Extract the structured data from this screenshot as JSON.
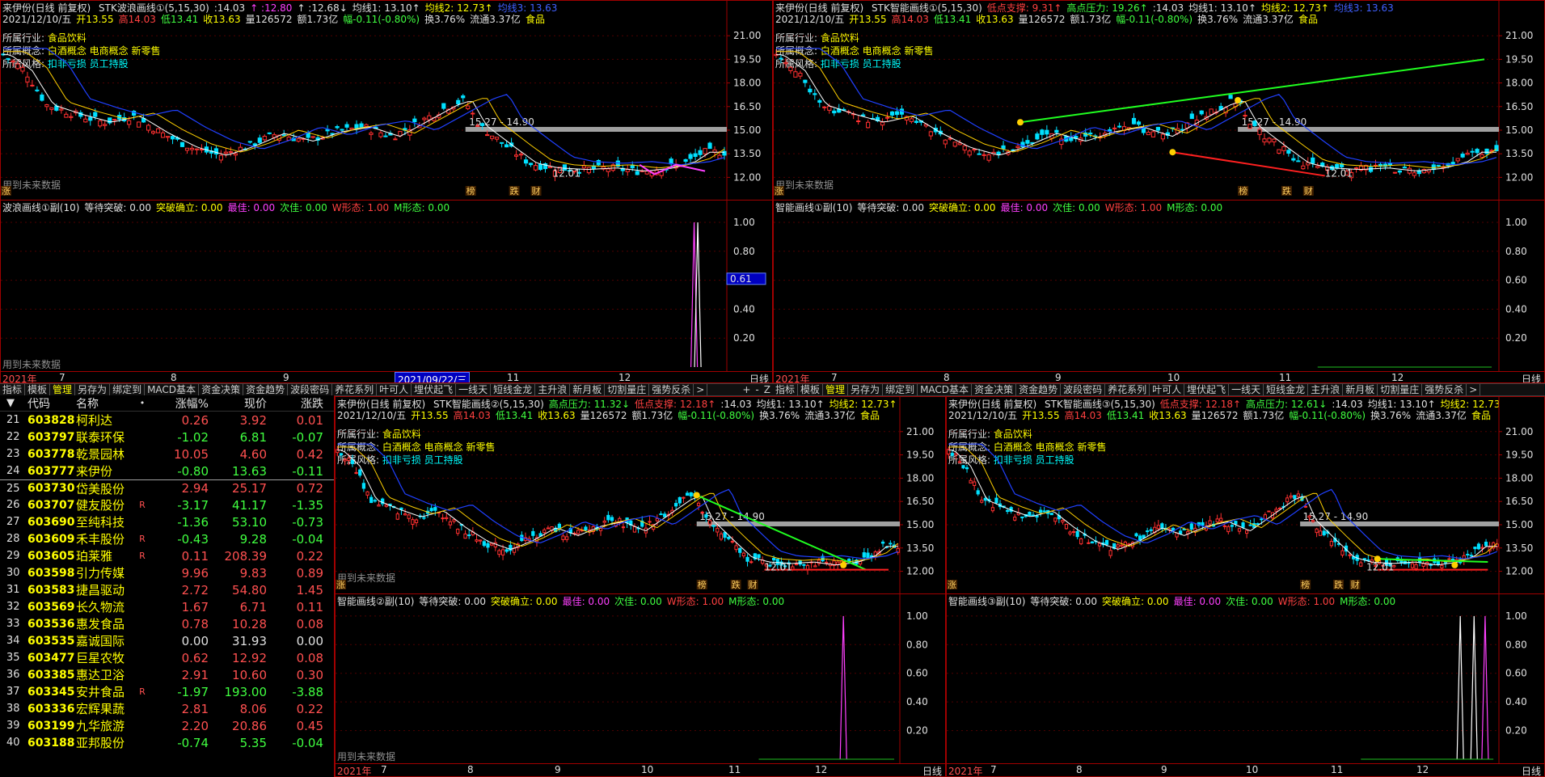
{
  "stock": {
    "name_period": "来伊份(日线 前复权)",
    "quote": [
      "2021/12/10/五",
      "开13.55",
      "高14.03",
      "低13.41",
      "收13.63",
      "量126572",
      "额1.73亿",
      "幅-0.11(-0.80%)",
      "换3.76%",
      "流通3.37亿",
      "食品"
    ],
    "industry_label": "所属行业:",
    "industry": "食品饮料",
    "concept_label": "所属概念:",
    "concept": "白酒概念 电商概念 新零售",
    "style_label": "所属风格:",
    "style": "扣非亏损 员工持股",
    "range_label": "15.27 - 14.90",
    "low_label": "12.01",
    "future_note": "用到未来数据",
    "marks": {
      "zhang": "涨",
      "bang": "榜",
      "die": "跌",
      "cai": "财"
    }
  },
  "panels": [
    {
      "id": "top-left",
      "title_items": [
        {
          "t": "STK波浪画线①(5,15,30)",
          "c": "c-w"
        },
        {
          "t": ":14.03",
          "c": "c-w"
        },
        {
          "t": "↑ :12.80",
          "c": "c-m"
        },
        {
          "t": "↑ :12.68↓",
          "c": "c-w"
        },
        {
          "t": "均线1: 13.10↑",
          "c": "c-w"
        },
        {
          "t": "均线2: 12.73↑",
          "c": "c-y"
        },
        {
          "t": "均线3: 13.63",
          "c": "c-b"
        }
      ],
      "yticks": [
        "21.00",
        "19.50",
        "18.00",
        "16.50",
        "15.00",
        "13.50",
        "12.00"
      ],
      "sub_title": [
        {
          "t": "波浪画线①副(10)",
          "c": "c-w"
        },
        {
          "t": "等待突破: 0.00",
          "c": "c-w"
        },
        {
          "t": "突破确立: 0.00",
          "c": "c-y"
        },
        {
          "t": "最佳: 0.00",
          "c": "c-m"
        },
        {
          "t": "次佳: 0.00",
          "c": "c-g"
        },
        {
          "t": "W形态: 1.00",
          "c": "c-r"
        },
        {
          "t": "M形态: 0.00",
          "c": "c-g"
        }
      ],
      "sub_yticks": [
        "1.00",
        "0.80",
        "0.60",
        "0.40",
        "0.20"
      ],
      "cursor_value": "0.61",
      "xaxis": [
        {
          "t": "2021年",
          "c": "yr"
        },
        {
          "t": "7"
        },
        {
          "t": "8"
        },
        {
          "t": "9"
        },
        {
          "t": "2021/09/22/三",
          "c": "cur"
        },
        {
          "t": "11"
        },
        {
          "t": "12"
        }
      ],
      "period": "日线"
    },
    {
      "id": "top-right",
      "title_items": [
        {
          "t": "STK智能画线①(5,15,30)",
          "c": "c-w"
        },
        {
          "t": "低点支撑: 9.31↑",
          "c": "c-r"
        },
        {
          "t": "高点压力: 19.26↑",
          "c": "c-g"
        },
        {
          "t": ":14.03",
          "c": "c-w"
        },
        {
          "t": "均线1: 13.10↑",
          "c": "c-w"
        },
        {
          "t": "均线2: 12.73↑",
          "c": "c-y"
        },
        {
          "t": "均线3: 13.63",
          "c": "c-b"
        }
      ],
      "yticks": [
        "21.00",
        "19.50",
        "18.00",
        "16.50",
        "15.00",
        "13.50",
        "12.00"
      ],
      "sub_title": [
        {
          "t": "智能画线①副(10)",
          "c": "c-w"
        },
        {
          "t": "等待突破: 0.00",
          "c": "c-w"
        },
        {
          "t": "突破确立: 0.00",
          "c": "c-y"
        },
        {
          "t": "最佳: 0.00",
          "c": "c-m"
        },
        {
          "t": "次佳: 0.00",
          "c": "c-g"
        },
        {
          "t": "W形态: 1.00",
          "c": "c-r"
        },
        {
          "t": "M形态: 0.00",
          "c": "c-g"
        }
      ],
      "sub_yticks": [
        "1.00",
        "0.80",
        "0.60",
        "0.40",
        "0.20"
      ],
      "xaxis": [
        {
          "t": "2021年",
          "c": "yr"
        },
        {
          "t": "7"
        },
        {
          "t": "8"
        },
        {
          "t": "9"
        },
        {
          "t": "10"
        },
        {
          "t": "11"
        },
        {
          "t": "12"
        }
      ],
      "period": "日线"
    },
    {
      "id": "bottom-mid",
      "title_items": [
        {
          "t": "STK智能画线②(5,15,30)",
          "c": "c-w"
        },
        {
          "t": "高点压力: 11.32↓",
          "c": "c-g"
        },
        {
          "t": "低点支撑: 12.18↑",
          "c": "c-r"
        },
        {
          "t": ":14.03",
          "c": "c-w"
        },
        {
          "t": "均线1: 13.10↑",
          "c": "c-w"
        },
        {
          "t": "均线2: 12.73↑",
          "c": "c-y"
        }
      ],
      "yticks": [
        "21.00",
        "19.50",
        "18.00",
        "16.50",
        "15.00",
        "13.50",
        "12.00"
      ],
      "sub_title": [
        {
          "t": "智能画线②副(10)",
          "c": "c-w"
        },
        {
          "t": "等待突破: 0.00",
          "c": "c-w"
        },
        {
          "t": "突破确立: 0.00",
          "c": "c-y"
        },
        {
          "t": "最佳: 0.00",
          "c": "c-m"
        },
        {
          "t": "次佳: 0.00",
          "c": "c-g"
        },
        {
          "t": "W形态: 1.00",
          "c": "c-r"
        },
        {
          "t": "M形态: 0.00",
          "c": "c-g"
        }
      ],
      "sub_yticks": [
        "1.00",
        "0.80",
        "0.60",
        "0.40",
        "0.20"
      ],
      "xaxis": [
        {
          "t": "2021年",
          "c": "yr"
        },
        {
          "t": "7"
        },
        {
          "t": "8"
        },
        {
          "t": "9"
        },
        {
          "t": "10"
        },
        {
          "t": "11"
        },
        {
          "t": "12"
        }
      ],
      "period": "日线"
    },
    {
      "id": "bottom-right",
      "title_items": [
        {
          "t": "STK智能画线③(5,15,30)",
          "c": "c-w"
        },
        {
          "t": "低点支撑: 12.18↑",
          "c": "c-r"
        },
        {
          "t": "高点压力: 12.61↓",
          "c": "c-g"
        },
        {
          "t": ":14.03",
          "c": "c-w"
        },
        {
          "t": "均线1: 13.10↑",
          "c": "c-w"
        },
        {
          "t": "均线2: 12.73",
          "c": "c-y"
        }
      ],
      "yticks": [
        "21.00",
        "19.50",
        "18.00",
        "16.50",
        "15.00",
        "13.50",
        "12.00"
      ],
      "sub_title": [
        {
          "t": "智能画线③副(10)",
          "c": "c-w"
        },
        {
          "t": "等待突破: 0.00",
          "c": "c-w"
        },
        {
          "t": "突破确立: 0.00",
          "c": "c-y"
        },
        {
          "t": "最佳: 0.00",
          "c": "c-m"
        },
        {
          "t": "次佳: 0.00",
          "c": "c-g"
        },
        {
          "t": "W形态: 1.00",
          "c": "c-r"
        },
        {
          "t": "M形态: 0.00",
          "c": "c-g"
        }
      ],
      "sub_yticks": [
        "1.00",
        "0.80",
        "0.60",
        "0.40",
        "0.20"
      ],
      "xaxis": [
        {
          "t": "2021年",
          "c": "yr"
        },
        {
          "t": "7"
        },
        {
          "t": "8"
        },
        {
          "t": "9"
        },
        {
          "t": "10"
        },
        {
          "t": "11"
        },
        {
          "t": "12"
        }
      ],
      "period": "日线"
    }
  ],
  "tabbar_left": [
    "指标",
    "模板",
    "管理",
    "另存为",
    "绑定到",
    "MACD基本",
    "资金决策",
    "资金趋势",
    "波段密码",
    "养花系列",
    "叶可人",
    "埋伏起飞",
    "一线天",
    "短线金龙",
    "主升浪",
    "新月板",
    "切割量庄",
    "强势反杀",
    ">"
  ],
  "tabbar_right": [
    "指标",
    "模板",
    "管理",
    "另存为",
    "绑定到",
    "MACD基本",
    "资金决策",
    "资金趋势",
    "波段密码",
    "养花系列",
    "叶可人",
    "埋伏起飞",
    "一线天",
    "短线金龙",
    "主升浪",
    "新月板",
    "切割量庄",
    "强势反杀",
    ">"
  ],
  "tabbar_ctrl": [
    "+",
    "-",
    "Z"
  ],
  "stocklist": {
    "headers": [
      "代码",
      "名称",
      "•",
      "涨幅%",
      "现价",
      "涨跌"
    ],
    "rows": [
      {
        "no": "21",
        "code": "603828",
        "name": "柯利达",
        "flag": "",
        "chg": "0.26",
        "price": "3.92",
        "diff": "0.01",
        "dir": "up"
      },
      {
        "no": "22",
        "code": "603797",
        "name": "联泰环保",
        "flag": "",
        "chg": "-1.02",
        "price": "6.81",
        "diff": "-0.07",
        "dir": "dn"
      },
      {
        "no": "23",
        "code": "603778",
        "name": "乾景园林",
        "flag": "",
        "chg": "10.05",
        "price": "4.60",
        "diff": "0.42",
        "dir": "up"
      },
      {
        "no": "24",
        "code": "603777",
        "name": "来伊份",
        "flag": "",
        "chg": "-0.80",
        "price": "13.63",
        "diff": "-0.11",
        "dir": "dn"
      },
      {
        "no": "25",
        "code": "603730",
        "name": "岱美股份",
        "flag": "",
        "chg": "2.94",
        "price": "25.17",
        "diff": "0.72",
        "dir": "up"
      },
      {
        "no": "26",
        "code": "603707",
        "name": "健友股份",
        "flag": "R",
        "chg": "-3.17",
        "price": "41.17",
        "diff": "-1.35",
        "dir": "dn"
      },
      {
        "no": "27",
        "code": "603690",
        "name": "至纯科技",
        "flag": "",
        "chg": "-1.36",
        "price": "53.10",
        "diff": "-0.73",
        "dir": "dn"
      },
      {
        "no": "28",
        "code": "603609",
        "name": "禾丰股份",
        "flag": "R",
        "chg": "-0.43",
        "price": "9.28",
        "diff": "-0.04",
        "dir": "dn"
      },
      {
        "no": "29",
        "code": "603605",
        "name": "珀莱雅",
        "flag": "R",
        "chg": "0.11",
        "price": "208.39",
        "diff": "0.22",
        "dir": "up"
      },
      {
        "no": "30",
        "code": "603598",
        "name": "引力传媒",
        "flag": "",
        "chg": "9.96",
        "price": "9.83",
        "diff": "0.89",
        "dir": "up"
      },
      {
        "no": "31",
        "code": "603583",
        "name": "捷昌驱动",
        "flag": "",
        "chg": "2.72",
        "price": "54.80",
        "diff": "1.45",
        "dir": "up"
      },
      {
        "no": "32",
        "code": "603569",
        "name": "长久物流",
        "flag": "",
        "chg": "1.67",
        "price": "6.71",
        "diff": "0.11",
        "dir": "up"
      },
      {
        "no": "33",
        "code": "603536",
        "name": "惠发食品",
        "flag": "",
        "chg": "0.78",
        "price": "10.28",
        "diff": "0.08",
        "dir": "up"
      },
      {
        "no": "34",
        "code": "603535",
        "name": "嘉诚国际",
        "flag": "",
        "chg": "0.00",
        "price": "31.93",
        "diff": "0.00",
        "dir": "flat"
      },
      {
        "no": "35",
        "code": "603477",
        "name": "巨星农牧",
        "flag": "",
        "chg": "0.62",
        "price": "12.92",
        "diff": "0.08",
        "dir": "up"
      },
      {
        "no": "36",
        "code": "603385",
        "name": "惠达卫浴",
        "flag": "",
        "chg": "2.91",
        "price": "10.60",
        "diff": "0.30",
        "dir": "up"
      },
      {
        "no": "37",
        "code": "603345",
        "name": "安井食品",
        "flag": "R",
        "chg": "-1.97",
        "price": "193.00",
        "diff": "-3.88",
        "dir": "dn"
      },
      {
        "no": "38",
        "code": "603336",
        "name": "宏辉果蔬",
        "flag": "",
        "chg": "2.81",
        "price": "8.06",
        "diff": "0.22",
        "dir": "up"
      },
      {
        "no": "39",
        "code": "603199",
        "name": "九华旅游",
        "flag": "",
        "chg": "2.20",
        "price": "20.86",
        "diff": "0.45",
        "dir": "up"
      },
      {
        "no": "40",
        "code": "603188",
        "name": "亚邦股份",
        "flag": "",
        "chg": "-0.74",
        "price": "5.35",
        "diff": "-0.04",
        "dir": "dn"
      }
    ]
  },
  "colors": {
    "up": "#ff3030",
    "down": "#00e0ff",
    "ma1": "#ffffff",
    "ma2": "#ffd000",
    "ma3": "#2040ff",
    "border": "#a00000"
  }
}
